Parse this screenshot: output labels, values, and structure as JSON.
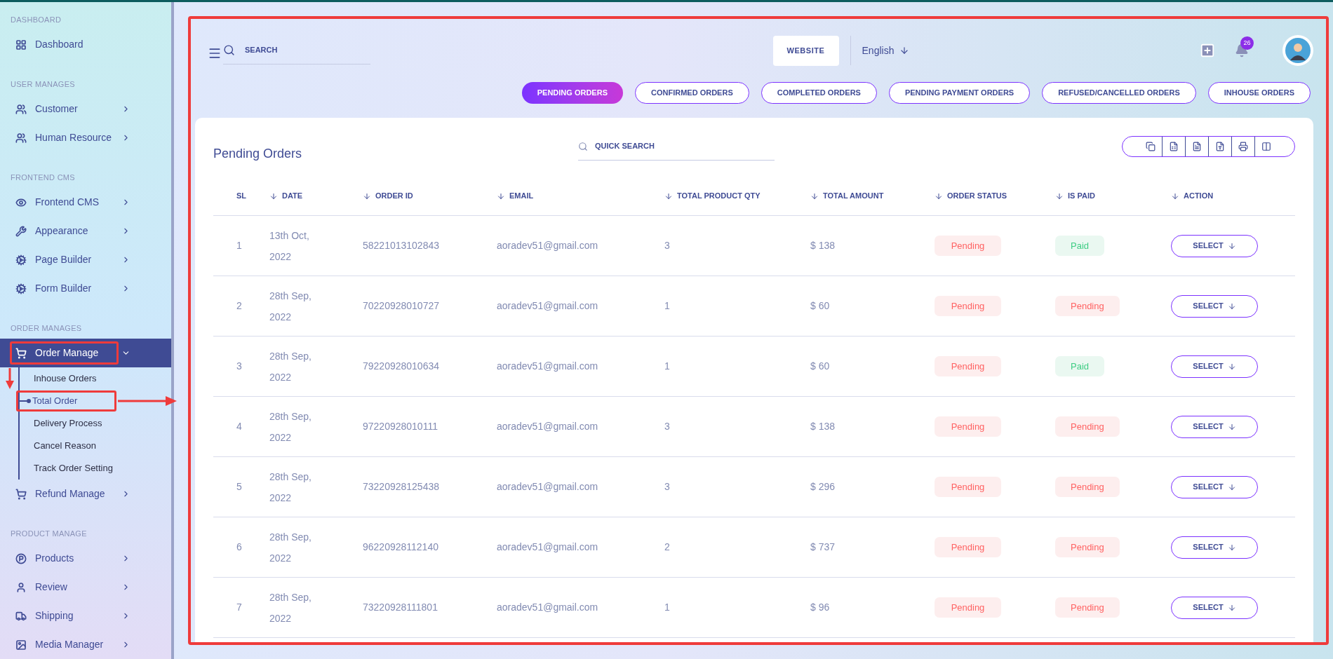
{
  "sidebar": {
    "sections": [
      {
        "title": "DASHBOARD",
        "items": [
          {
            "label": "Dashboard",
            "has_submenu": false,
            "expanded": false,
            "selected": false
          }
        ]
      },
      {
        "title": "USER MANAGES",
        "items": [
          {
            "label": "Customer",
            "has_submenu": true,
            "expanded": false,
            "selected": false
          },
          {
            "label": "Human Resource",
            "has_submenu": true,
            "expanded": false,
            "selected": false
          }
        ]
      },
      {
        "title": "FRONTEND CMS",
        "items": [
          {
            "label": "Frontend CMS",
            "has_submenu": true,
            "expanded": false,
            "selected": false
          },
          {
            "label": "Appearance",
            "has_submenu": true,
            "expanded": false,
            "selected": false
          },
          {
            "label": "Page Builder",
            "has_submenu": true,
            "expanded": false,
            "selected": false
          },
          {
            "label": "Form Builder",
            "has_submenu": true,
            "expanded": false,
            "selected": false
          }
        ]
      },
      {
        "title": "ORDER MANAGES",
        "items": [
          {
            "label": "Order Manage",
            "expanded": true,
            "selected": true,
            "children": [
              {
                "label": "Inhouse Orders",
                "selected": false
              },
              {
                "label": "Total Order",
                "selected": true
              },
              {
                "label": "Delivery Process",
                "selected": false
              },
              {
                "label": "Cancel Reason",
                "selected": false
              },
              {
                "label": "Track Order Setting",
                "selected": false
              }
            ]
          },
          {
            "label": "Refund Manage",
            "has_submenu": true,
            "expanded": false,
            "selected": false
          }
        ]
      },
      {
        "title": "PRODUCT MANAGE",
        "items": [
          {
            "label": "Products",
            "has_submenu": true,
            "expanded": false,
            "selected": false
          },
          {
            "label": "Review",
            "has_submenu": true,
            "expanded": false,
            "selected": false
          },
          {
            "label": "Shipping",
            "has_submenu": true,
            "expanded": false,
            "selected": false
          },
          {
            "label": "Media Manager",
            "has_submenu": true,
            "expanded": false,
            "selected": false
          }
        ]
      }
    ]
  },
  "header": {
    "search": {
      "placeholder": "SEARCH"
    },
    "website_button": "WEBSITE",
    "language": "English",
    "notification_count": "26"
  },
  "tabs": [
    {
      "label": "PENDING ORDERS",
      "selected": true
    },
    {
      "label": "CONFIRMED ORDERS",
      "selected": false
    },
    {
      "label": "COMPLETED ORDERS",
      "selected": false
    },
    {
      "label": "PENDING PAYMENT ORDERS",
      "selected": false
    },
    {
      "label": "REFUSED/CANCELLED ORDERS",
      "selected": false
    },
    {
      "label": "INHOUSE ORDERS",
      "selected": false
    }
  ],
  "card": {
    "title": "Pending Orders",
    "quick_search": {
      "placeholder": "QUICK SEARCH"
    }
  },
  "table": {
    "columns": [
      {
        "label": "SL",
        "sortable": false
      },
      {
        "label": "DATE",
        "sortable": true
      },
      {
        "label": "ORDER ID",
        "sortable": true
      },
      {
        "label": "EMAIL",
        "sortable": true
      },
      {
        "label": "TOTAL PRODUCT QTY",
        "sortable": true
      },
      {
        "label": "TOTAL AMOUNT",
        "sortable": true
      },
      {
        "label": "ORDER STATUS",
        "sortable": true
      },
      {
        "label": "IS PAID",
        "sortable": true
      },
      {
        "label": "ACTION",
        "sortable": true
      }
    ],
    "rows": [
      {
        "sl": "1",
        "date": "13th Oct,",
        "year": "2022",
        "order_id": "58221013102843",
        "email": "aoradev51@gmail.com",
        "qty": "3",
        "amount": "$ 138",
        "order_status": "Pending",
        "is_paid": "Paid",
        "paid": true,
        "action": "SELECT"
      },
      {
        "sl": "2",
        "date": "28th Sep,",
        "year": "2022",
        "order_id": "70220928010727",
        "email": "aoradev51@gmail.com",
        "qty": "1",
        "amount": "$ 60",
        "order_status": "Pending",
        "is_paid": "Pending",
        "paid": false,
        "action": "SELECT"
      },
      {
        "sl": "3",
        "date": "28th Sep,",
        "year": "2022",
        "order_id": "79220928010634",
        "email": "aoradev51@gmail.com",
        "qty": "1",
        "amount": "$ 60",
        "order_status": "Pending",
        "is_paid": "Paid",
        "paid": true,
        "action": "SELECT"
      },
      {
        "sl": "4",
        "date": "28th Sep,",
        "year": "2022",
        "order_id": "97220928010111",
        "email": "aoradev51@gmail.com",
        "qty": "3",
        "amount": "$ 138",
        "order_status": "Pending",
        "is_paid": "Pending",
        "paid": false,
        "action": "SELECT"
      },
      {
        "sl": "5",
        "date": "28th Sep,",
        "year": "2022",
        "order_id": "73220928125438",
        "email": "aoradev51@gmail.com",
        "qty": "3",
        "amount": "$ 296",
        "order_status": "Pending",
        "is_paid": "Pending",
        "paid": false,
        "action": "SELECT"
      },
      {
        "sl": "6",
        "date": "28th Sep,",
        "year": "2022",
        "order_id": "96220928112140",
        "email": "aoradev51@gmail.com",
        "qty": "2",
        "amount": "$ 737",
        "order_status": "Pending",
        "is_paid": "Pending",
        "paid": false,
        "action": "SELECT"
      },
      {
        "sl": "7",
        "date": "28th Sep,",
        "year": "2022",
        "order_id": "73220928111801",
        "email": "aoradev51@gmail.com",
        "qty": "1",
        "amount": "$ 96",
        "order_status": "Pending",
        "is_paid": "Pending",
        "paid": false,
        "action": "SELECT"
      }
    ]
  }
}
